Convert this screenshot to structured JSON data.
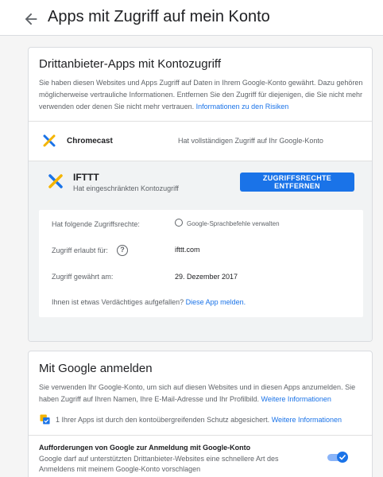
{
  "header": {
    "title": "Apps mit Zugriff auf mein Konto",
    "back_icon": "arrow-back-icon"
  },
  "third_party": {
    "title": "Drittanbieter-Apps mit Kontozugriff",
    "description": "Sie haben diesen Websites und Apps Zugriff auf Daten in Ihrem Google-Konto gewährt. Dazu gehören möglicherweise vertrauliche Informationen. Entfernen Sie den Zugriff für diejenigen, die Sie nicht mehr verwenden oder denen Sie nicht mehr vertrauen.",
    "risk_link": "Informationen zu den Risiken",
    "apps": [
      {
        "name": "Chromecast",
        "access": "Hat vollständigen Zugriff auf Ihr Google-Konto",
        "icon": "chromecast-logo-icon"
      }
    ],
    "expanded_app": {
      "name": "IFTTT",
      "access": "Hat eingeschränkten Kontozugriff",
      "icon": "ifttt-logo-icon",
      "remove_button": "ZUGRIFFSRECHTE ENTFERNEN",
      "details": {
        "permissions_label": "Hat folgende Zugriffsrechte:",
        "permissions_value": "Google-Sprachbefehle verwalten",
        "allowed_for_label": "Zugriff erlaubt für:",
        "allowed_for_value": "ifttt.com",
        "granted_label": "Zugriff gewährt am:",
        "granted_value": "29. Dezember 2017",
        "report_text": "Ihnen ist etwas Verdächtiges aufgefallen?",
        "report_link": "Diese App melden."
      }
    }
  },
  "sign_in": {
    "title": "Mit Google anmelden",
    "description": "Sie verwenden Ihr Google-Konto, um sich auf diesen Websites und in diesen Apps anzumelden. Sie haben Zugriff auf Ihren Namen, Ihre E-Mail-Adresse und Ihr Profilbild.",
    "more_link": "Weitere Informationen",
    "protection_text": "1 Ihrer Apps ist durch den kontoübergreifenden Schutz abgesichert.",
    "protection_link": "Weitere Informationen",
    "pref_title": "Aufforderungen von Google zur Anmeldung mit Google-Konto",
    "pref_desc": "Google darf auf unterstützten Drittanbieter-Websites eine schnellere Art des Anmeldens mit meinem Google-Konto vorschlagen",
    "toggle_on": true
  },
  "colors": {
    "accent": "#1a73e8",
    "card_bg": "#ffffff",
    "page_bg": "#f5f5f5",
    "expanded_bg": "#f1f3f4"
  }
}
